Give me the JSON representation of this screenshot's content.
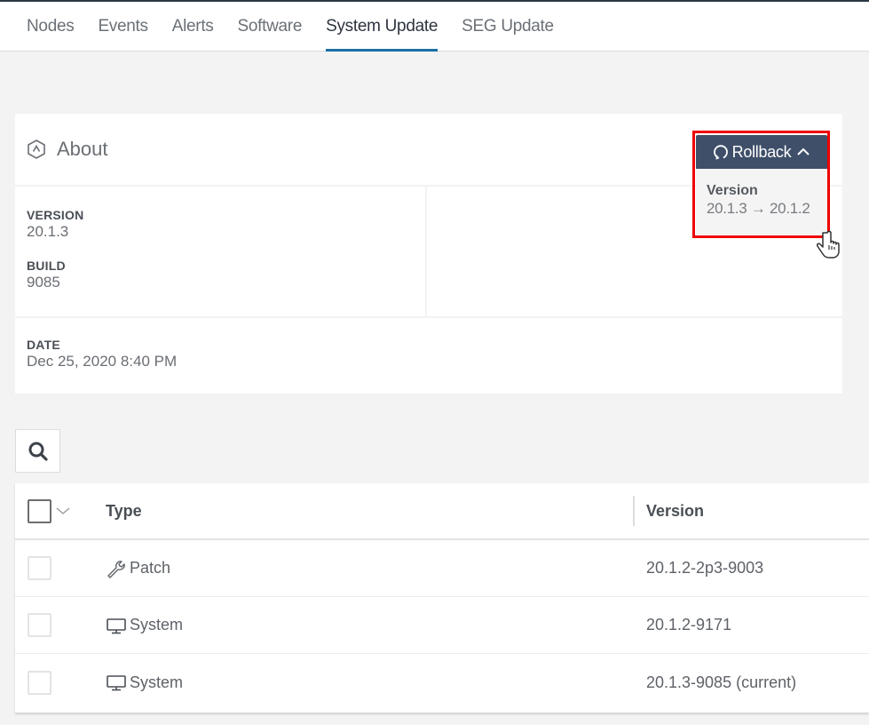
{
  "tabs": [
    {
      "label": "Nodes",
      "active": false
    },
    {
      "label": "Events",
      "active": false
    },
    {
      "label": "Alerts",
      "active": false
    },
    {
      "label": "Software",
      "active": false
    },
    {
      "label": "System Update",
      "active": true
    },
    {
      "label": "SEG Update",
      "active": false
    }
  ],
  "about": {
    "title": "About",
    "icon": "hexagon-chevron-up-icon",
    "version_label": "VERSION",
    "version_value": "20.1.3",
    "build_label": "BUILD",
    "build_value": "9085",
    "date_label": "DATE",
    "date_value": "Dec 25, 2020 8:40 PM"
  },
  "rollback": {
    "label": "Rollback",
    "icon": "refresh-icon",
    "chevron": "chevron-up-icon",
    "popover_label": "Version",
    "popover_value": "20.1.3 → 20.1.2"
  },
  "colors": {
    "accent": "#1a6fa3",
    "rollback_bg": "#3f4f69",
    "highlight": "#ee0000"
  },
  "table": {
    "search_icon": "search-icon",
    "columns": [
      "Type",
      "Version"
    ],
    "rows": [
      {
        "type": "Patch",
        "icon": "wrench-icon",
        "version": "20.1.2-2p3-9003"
      },
      {
        "type": "System",
        "icon": "monitor-icon",
        "version": "20.1.2-9171"
      },
      {
        "type": "System",
        "icon": "monitor-icon",
        "version": "20.1.3-9085 (current)"
      }
    ]
  }
}
